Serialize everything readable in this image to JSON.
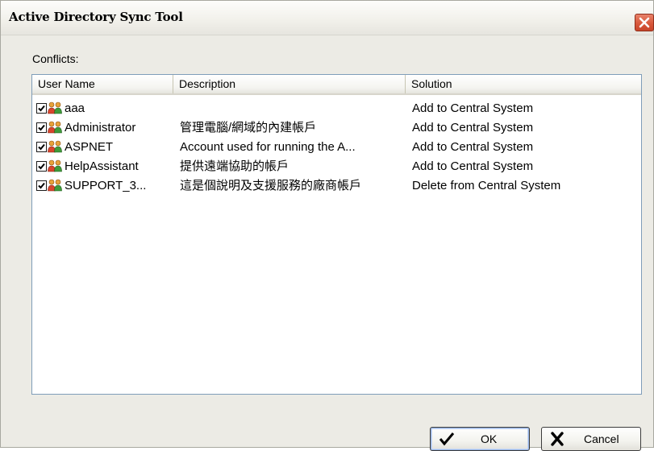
{
  "window": {
    "title": "Active Directory Sync Tool"
  },
  "conflicts_label": "Conflicts:",
  "table": {
    "columns": [
      "User Name",
      "Description",
      "Solution"
    ],
    "rows": [
      {
        "checked": true,
        "name": "aaa",
        "description": "",
        "solution": "Add to Central System"
      },
      {
        "checked": true,
        "name": "Administrator",
        "description": "管理電腦/網域的內建帳戶",
        "solution": "Add to Central System"
      },
      {
        "checked": true,
        "name": "ASPNET",
        "description": "Account used for running the A...",
        "solution": "Add to Central System"
      },
      {
        "checked": true,
        "name": "HelpAssistant",
        "description": "提供遠端協助的帳戶",
        "solution": "Add to Central System"
      },
      {
        "checked": true,
        "name": "SUPPORT_3...",
        "description": "這是個說明及支援服務的廠商帳戶",
        "solution": "Delete from Central System"
      }
    ]
  },
  "buttons": {
    "ok_label": "OK",
    "cancel_label": "Cancel"
  },
  "icons": {
    "close": "close-icon",
    "user": "user-group-icon",
    "checkbox": "checkbox-checked-icon",
    "ok": "checkmark-icon",
    "cancel": "x-icon"
  },
  "colors": {
    "close_button": "#d8583b",
    "window_bg": "#ecebe5",
    "list_border": "#7f9db9"
  }
}
